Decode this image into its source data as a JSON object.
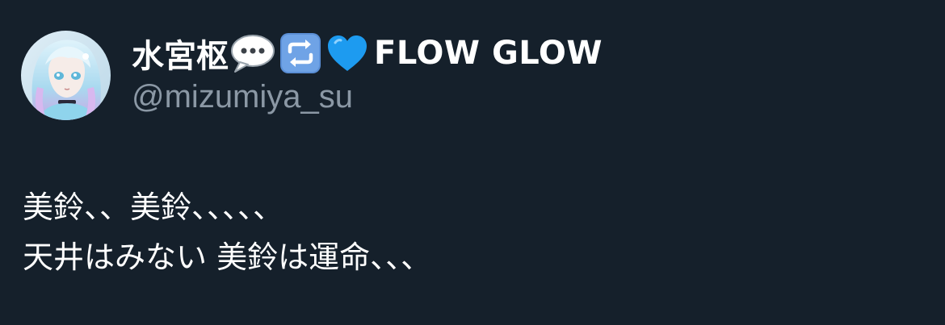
{
  "author": {
    "display_name": "水宮枢",
    "name_emojis": [
      "speech-bubble-emoji",
      "repeat-emoji",
      "blue-heart-emoji"
    ],
    "name_suffix": "FLOW GLOW",
    "handle": "@mizumiya_su"
  },
  "tweet": {
    "lines": [
      "美鈴、、美鈴、、、、、",
      "天井はみない 美鈴は運命、、、"
    ]
  },
  "colors": {
    "background": "#15202b",
    "text": "#ffffff",
    "handle": "#8b98a5",
    "accent_blue": "#1d9bf0"
  }
}
